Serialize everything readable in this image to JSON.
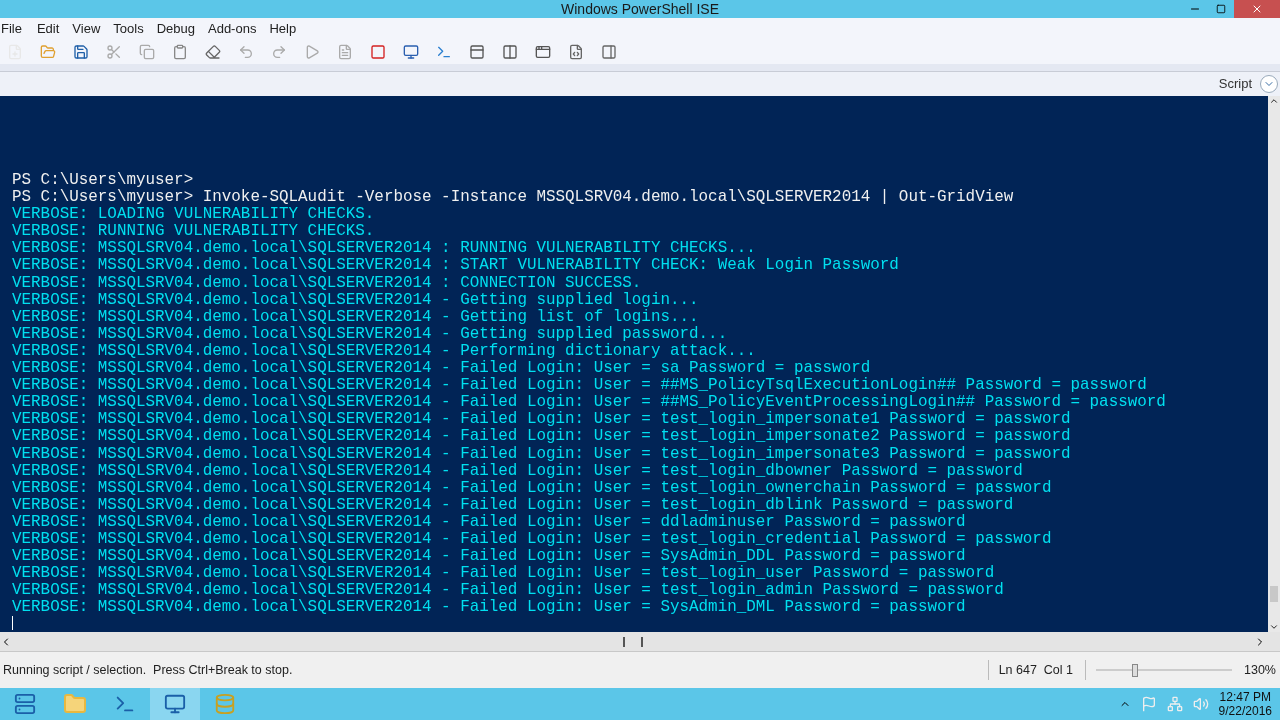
{
  "window": {
    "title": "Windows PowerShell ISE"
  },
  "menu": [
    "File",
    "Edit",
    "View",
    "Tools",
    "Debug",
    "Add-ons",
    "Help"
  ],
  "script_pane_label": "Script",
  "console": [
    {
      "kind": "prompt",
      "text": "PS C:\\Users\\myuser>"
    },
    {
      "kind": "prompt",
      "text": "PS C:\\Users\\myuser> Invoke-SQLAudit -Verbose -Instance MSSQLSRV04.demo.local\\SQLSERVER2014 | Out-GridView"
    },
    {
      "kind": "verbose",
      "text": "VERBOSE: LOADING VULNERABILITY CHECKS."
    },
    {
      "kind": "verbose",
      "text": "VERBOSE: RUNNING VULNERABILITY CHECKS."
    },
    {
      "kind": "verbose",
      "text": "VERBOSE: MSSQLSRV04.demo.local\\SQLSERVER2014 : RUNNING VULNERABILITY CHECKS..."
    },
    {
      "kind": "verbose",
      "text": "VERBOSE: MSSQLSRV04.demo.local\\SQLSERVER2014 : START VULNERABILITY CHECK: Weak Login Password"
    },
    {
      "kind": "verbose",
      "text": "VERBOSE: MSSQLSRV04.demo.local\\SQLSERVER2014 : CONNECTION SUCCESS."
    },
    {
      "kind": "verbose",
      "text": "VERBOSE: MSSQLSRV04.demo.local\\SQLSERVER2014 - Getting supplied login..."
    },
    {
      "kind": "verbose",
      "text": "VERBOSE: MSSQLSRV04.demo.local\\SQLSERVER2014 - Getting list of logins..."
    },
    {
      "kind": "verbose",
      "text": "VERBOSE: MSSQLSRV04.demo.local\\SQLSERVER2014 - Getting supplied password..."
    },
    {
      "kind": "verbose",
      "text": "VERBOSE: MSSQLSRV04.demo.local\\SQLSERVER2014 - Performing dictionary attack..."
    },
    {
      "kind": "verbose",
      "text": "VERBOSE: MSSQLSRV04.demo.local\\SQLSERVER2014 - Failed Login: User = sa Password = password"
    },
    {
      "kind": "verbose",
      "text": "VERBOSE: MSSQLSRV04.demo.local\\SQLSERVER2014 - Failed Login: User = ##MS_PolicyTsqlExecutionLogin## Password = password"
    },
    {
      "kind": "verbose",
      "text": "VERBOSE: MSSQLSRV04.demo.local\\SQLSERVER2014 - Failed Login: User = ##MS_PolicyEventProcessingLogin## Password = password"
    },
    {
      "kind": "verbose",
      "text": "VERBOSE: MSSQLSRV04.demo.local\\SQLSERVER2014 - Failed Login: User = test_login_impersonate1 Password = password"
    },
    {
      "kind": "verbose",
      "text": "VERBOSE: MSSQLSRV04.demo.local\\SQLSERVER2014 - Failed Login: User = test_login_impersonate2 Password = password"
    },
    {
      "kind": "verbose",
      "text": "VERBOSE: MSSQLSRV04.demo.local\\SQLSERVER2014 - Failed Login: User = test_login_impersonate3 Password = password"
    },
    {
      "kind": "verbose",
      "text": "VERBOSE: MSSQLSRV04.demo.local\\SQLSERVER2014 - Failed Login: User = test_login_dbowner Password = password"
    },
    {
      "kind": "verbose",
      "text": "VERBOSE: MSSQLSRV04.demo.local\\SQLSERVER2014 - Failed Login: User = test_login_ownerchain Password = password"
    },
    {
      "kind": "verbose",
      "text": "VERBOSE: MSSQLSRV04.demo.local\\SQLSERVER2014 - Failed Login: User = test_login_dblink Password = password"
    },
    {
      "kind": "verbose",
      "text": "VERBOSE: MSSQLSRV04.demo.local\\SQLSERVER2014 - Failed Login: User = ddladminuser Password = password"
    },
    {
      "kind": "verbose",
      "text": "VERBOSE: MSSQLSRV04.demo.local\\SQLSERVER2014 - Failed Login: User = test_login_credential Password = password"
    },
    {
      "kind": "verbose",
      "text": "VERBOSE: MSSQLSRV04.demo.local\\SQLSERVER2014 - Failed Login: User = SysAdmin_DDL Password = password"
    },
    {
      "kind": "verbose",
      "text": "VERBOSE: MSSQLSRV04.demo.local\\SQLSERVER2014 - Failed Login: User = test_login_user Password = password"
    },
    {
      "kind": "verbose",
      "text": "VERBOSE: MSSQLSRV04.demo.local\\SQLSERVER2014 - Failed Login: User = test_login_admin Password = password"
    },
    {
      "kind": "verbose",
      "text": "VERBOSE: MSSQLSRV04.demo.local\\SQLSERVER2014 - Failed Login: User = SysAdmin_DML Password = password"
    }
  ],
  "status_bar": {
    "message": "Running script / selection.  Press Ctrl+Break to stop.",
    "position": "Ln 647  Col 1",
    "zoom": {
      "level": 0.29,
      "reading": "130%"
    }
  },
  "taskbar": {
    "time": "12:47 PM",
    "date": "9/22/2016"
  }
}
